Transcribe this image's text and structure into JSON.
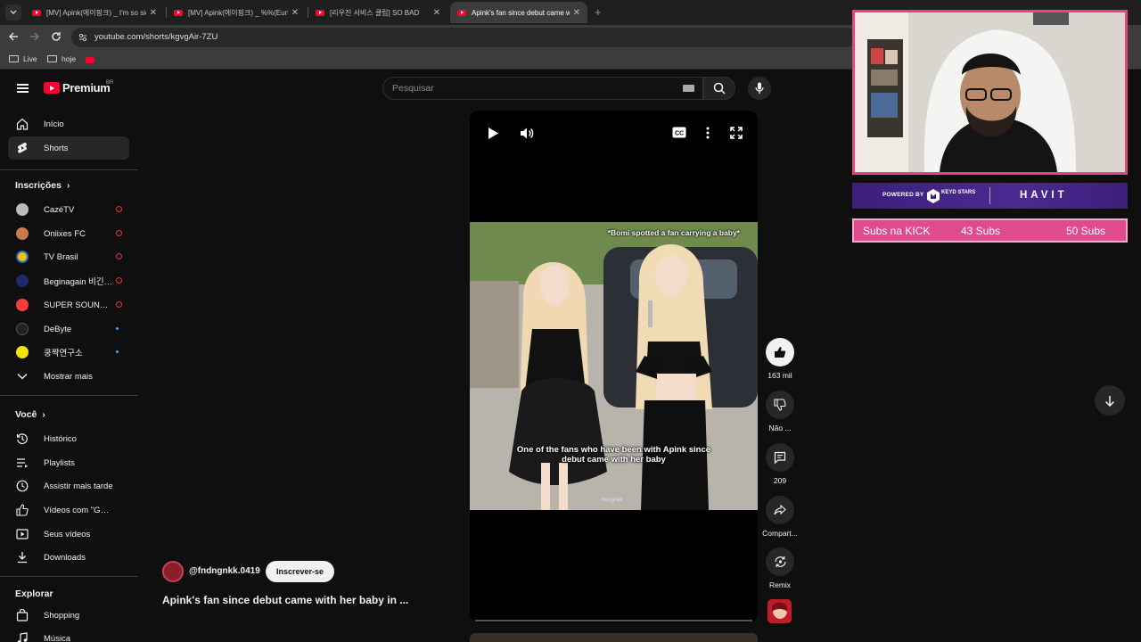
{
  "browser": {
    "tabs": [
      {
        "label": "[MV] Apink(에이핑크) _ I'm so sick",
        "active": false
      },
      {
        "label": "[MV] Apink(에이핑크) _ %%(Eung Eung)",
        "active": false
      },
      {
        "label": "[리우진 서비스 클립] SO BAD",
        "active": false
      },
      {
        "label": "Apink's fan since debut came with her baby",
        "active": true
      }
    ],
    "url": "youtube.com/shorts/kgvgAir-7ZU",
    "bookmarks": [
      "Live",
      "hoje"
    ]
  },
  "header": {
    "logo_text": "Premium",
    "country_code": "BR",
    "search_placeholder": "Pesquisar"
  },
  "sidebar": {
    "main": [
      {
        "label": "Início",
        "icon": "home-icon"
      },
      {
        "label": "Shorts",
        "icon": "shorts-icon"
      }
    ],
    "subscriptions_title": "Inscrições",
    "subscriptions": [
      {
        "label": "CazéTV",
        "status": "live",
        "color": "#ccc"
      },
      {
        "label": "Oniixes FC",
        "status": "live",
        "color": "#c97a4a"
      },
      {
        "label": "TV Brasil",
        "status": "live",
        "color": "#f2c100"
      },
      {
        "label": "Beginagain 비긴어게인",
        "status": "live",
        "color": "#1b2b6b"
      },
      {
        "label": "SUPER SOUND Bugs!",
        "status": "live",
        "color": "#ff3b3b"
      },
      {
        "label": "DeByte",
        "status": "new",
        "color": "#222"
      },
      {
        "label": "쿵짝연구소",
        "status": "new",
        "color": "#f5e400"
      }
    ],
    "show_more": "Mostrar mais",
    "you_title": "Você",
    "you_items": [
      {
        "label": "Histórico",
        "icon": "history-icon"
      },
      {
        "label": "Playlists",
        "icon": "playlists-icon"
      },
      {
        "label": "Assistir mais tarde",
        "icon": "watch-later-icon"
      },
      {
        "label": "Vídeos com \"Gostei\"",
        "icon": "liked-icon"
      },
      {
        "label": "Seus vídeos",
        "icon": "your-videos-icon"
      },
      {
        "label": "Downloads",
        "icon": "downloads-icon"
      }
    ],
    "explore_title": "Explorar",
    "explore_items": [
      {
        "label": "Shopping",
        "icon": "shopping-icon"
      },
      {
        "label": "Música",
        "icon": "music-icon"
      }
    ]
  },
  "video": {
    "overlay_top": "*Bomi spotted a fan carrying a baby*",
    "caption": "One of the fans who have been with Apink since debut came with her baby",
    "watermark": "fndngnkk",
    "progress": 0.0
  },
  "actions": {
    "likes": "163 mil",
    "dislike": "Não ...",
    "comments": "209",
    "share": "Compart...",
    "remix": "Remix"
  },
  "channel": {
    "handle": "@fndngnkk.0419",
    "subscribe_label": "Inscrever-se",
    "title": "Apink's fan since debut came with her baby in ..."
  },
  "stream": {
    "powered_by": "POWERED BY",
    "sponsor_a": "KEYD STARS",
    "sponsor_b": "HAVIT",
    "subs_label": "Subs na KICK",
    "subs_current": "43 Subs",
    "subs_goal": "50 Subs"
  }
}
